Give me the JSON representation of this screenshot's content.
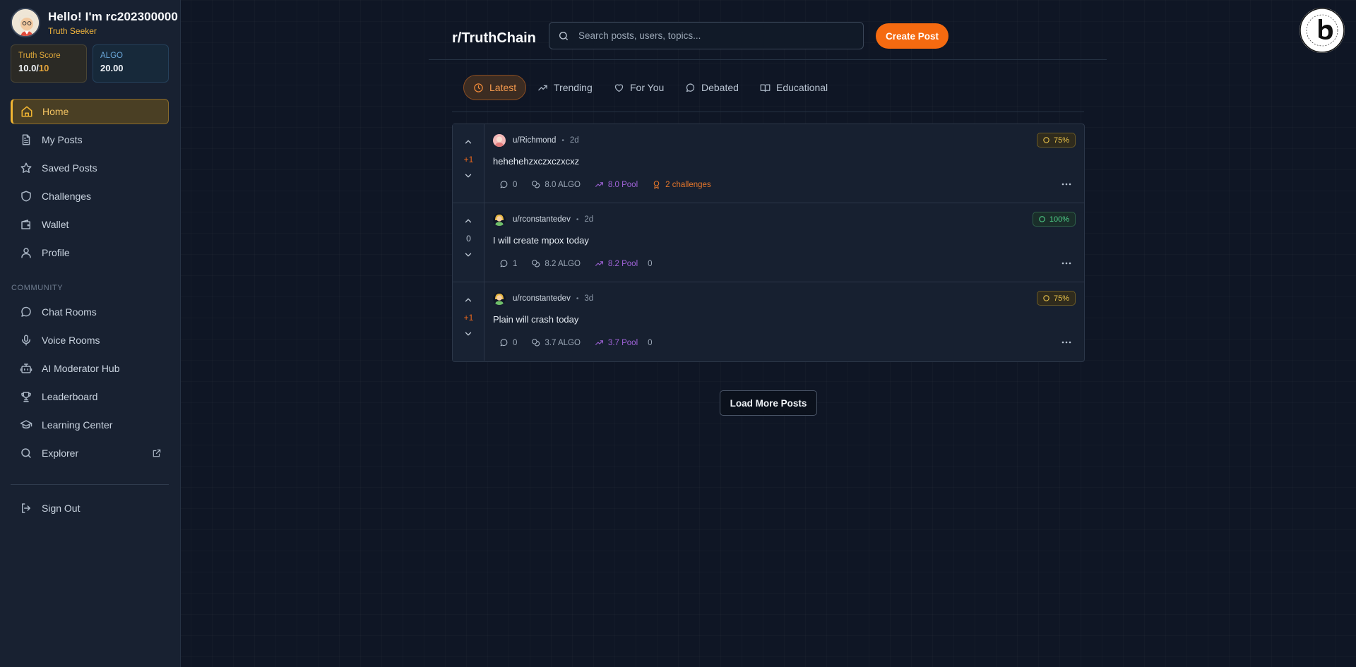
{
  "user": {
    "greeting": "Hello! I'm rc202300000",
    "rank": "Truth Seeker"
  },
  "stats": {
    "truth_label": "Truth Score",
    "truth_value": "10.0/",
    "truth_denom": "10",
    "algo_label": "ALGO",
    "algo_value": "20.00"
  },
  "nav": {
    "items": [
      {
        "label": "Home",
        "icon": "home-icon",
        "active": true
      },
      {
        "label": "My Posts",
        "icon": "document-icon"
      },
      {
        "label": "Saved Posts",
        "icon": "star-icon"
      },
      {
        "label": "Challenges",
        "icon": "shield-icon"
      },
      {
        "label": "Wallet",
        "icon": "wallet-icon"
      },
      {
        "label": "Profile",
        "icon": "user-icon"
      }
    ],
    "community_title": "COMMUNITY",
    "community_items": [
      {
        "label": "Chat Rooms",
        "icon": "chat-icon"
      },
      {
        "label": "Voice Rooms",
        "icon": "microphone-icon"
      },
      {
        "label": "AI Moderator Hub",
        "icon": "robot-icon"
      },
      {
        "label": "Leaderboard",
        "icon": "trophy-icon"
      },
      {
        "label": "Learning Center",
        "icon": "graduation-cap-icon"
      },
      {
        "label": "Explorer",
        "icon": "search-icon",
        "external": "external-link-icon"
      }
    ],
    "signout": "Sign Out"
  },
  "header": {
    "brand": "r/TruthChain",
    "search_placeholder": "Search posts, users, topics...",
    "create_label": "Create Post"
  },
  "tabs": [
    {
      "label": "Latest",
      "icon": "clock-icon",
      "active": true
    },
    {
      "label": "Trending",
      "icon": "trending-icon"
    },
    {
      "label": "For You",
      "icon": "heart-icon"
    },
    {
      "label": "Debated",
      "icon": "chat-icon"
    },
    {
      "label": "Educational",
      "icon": "book-icon"
    }
  ],
  "posts": [
    {
      "score": "+1",
      "username": "u/Richmond",
      "time": "2d",
      "confidence": "75%",
      "confidence_color": "#e8c24a",
      "content": "hehehehzxczxczxcxz",
      "comments": "0",
      "stake": "8.0 ALGO",
      "pool": "8.0 Pool",
      "challenges": "2 challenges"
    },
    {
      "score": "0",
      "username": "u/rconstantedev",
      "time": "2d",
      "confidence": "100%",
      "confidence_color": "#4fd08a",
      "content": "I will create mpox today",
      "comments": "1",
      "stake": "8.2 ALGO",
      "pool": "8.2 Pool",
      "extra": "0"
    },
    {
      "score": "+1",
      "username": "u/rconstantedev",
      "time": "3d",
      "confidence": "75%",
      "confidence_color": "#e8c24a",
      "content": "Plain will crash today",
      "comments": "0",
      "stake": "3.7 ALGO",
      "pool": "3.7 Pool",
      "extra": "0"
    }
  ],
  "load_more": "Load More Posts",
  "colors": {
    "accent": "#f56a10",
    "gold": "#f2b632",
    "background": "#0f1625",
    "sidebar": "#182131"
  }
}
